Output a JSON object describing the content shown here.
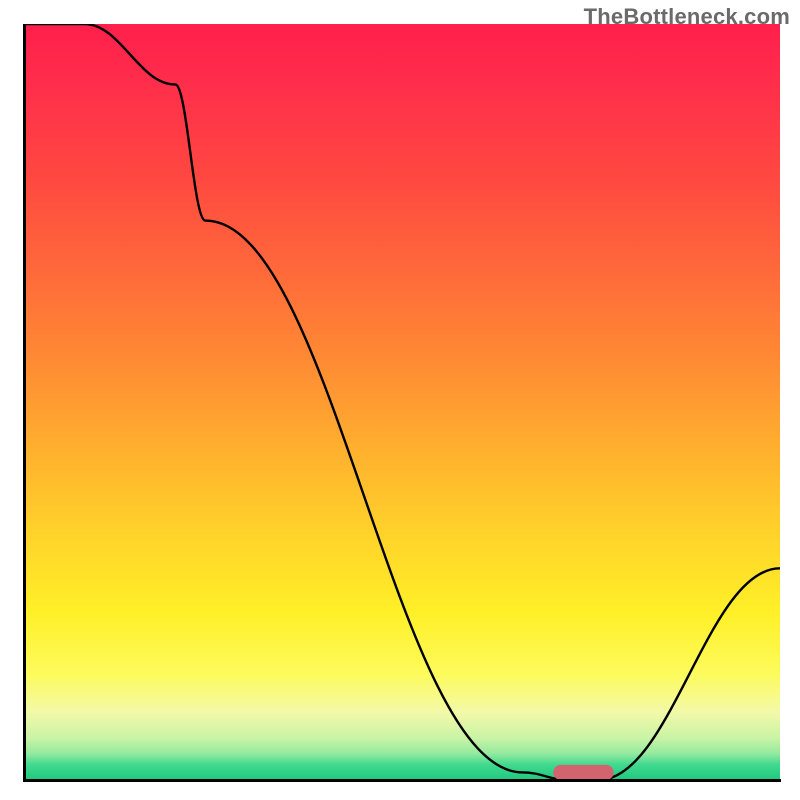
{
  "watermark": "TheBottleneck.com",
  "chart_data": {
    "type": "line",
    "title": "",
    "xlabel": "",
    "ylabel": "",
    "xlim": [
      0,
      100
    ],
    "ylim": [
      0,
      100
    ],
    "grid": false,
    "background": "vertical-gradient-red-to-green",
    "curve": {
      "name": "bottleneck-curve",
      "x": [
        0,
        8,
        20,
        24,
        66,
        72,
        76,
        100
      ],
      "y": [
        100,
        100,
        92,
        74,
        1,
        0,
        0,
        28
      ]
    },
    "marker": {
      "name": "optimal-marker",
      "shape": "pill",
      "color": "#d3636f",
      "x_center": 74,
      "y": 0,
      "width_pct": 8,
      "height_pct": 2.0
    }
  },
  "colors": {
    "axis": "#000000",
    "curve": "#000000",
    "marker": "#d3636f",
    "watermark": "#6a6a6a"
  }
}
